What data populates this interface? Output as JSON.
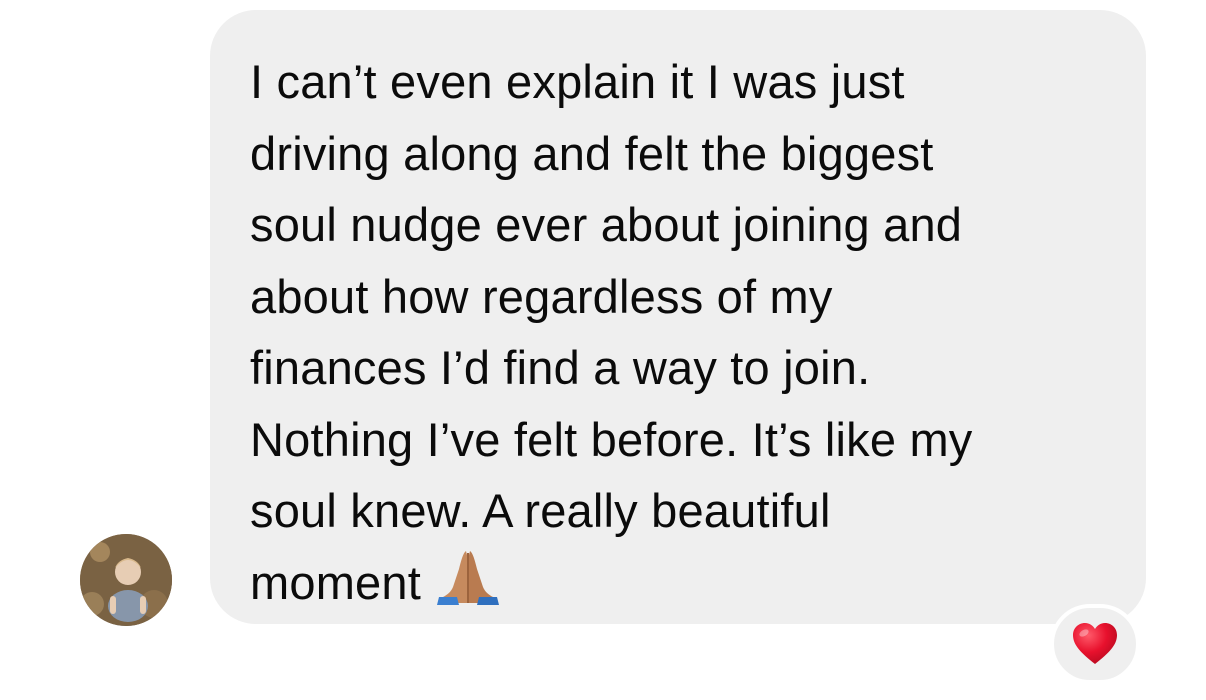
{
  "message": {
    "lines": [
      "I can’t even explain it I was just",
      "driving along and felt the biggest",
      "soul nudge ever about joining and",
      "about how regardless of my",
      "finances I’d find a way to join.",
      "Nothing I’ve felt before. It’s like my",
      "soul knew. A really beautiful",
      "moment"
    ],
    "emoji": "folded-hands-icon"
  },
  "reaction": {
    "emoji": "red-heart-icon",
    "color": "#e8112d"
  },
  "colors": {
    "bubble": "#efefef",
    "text": "#0b0b0b",
    "background": "#ffffff"
  }
}
